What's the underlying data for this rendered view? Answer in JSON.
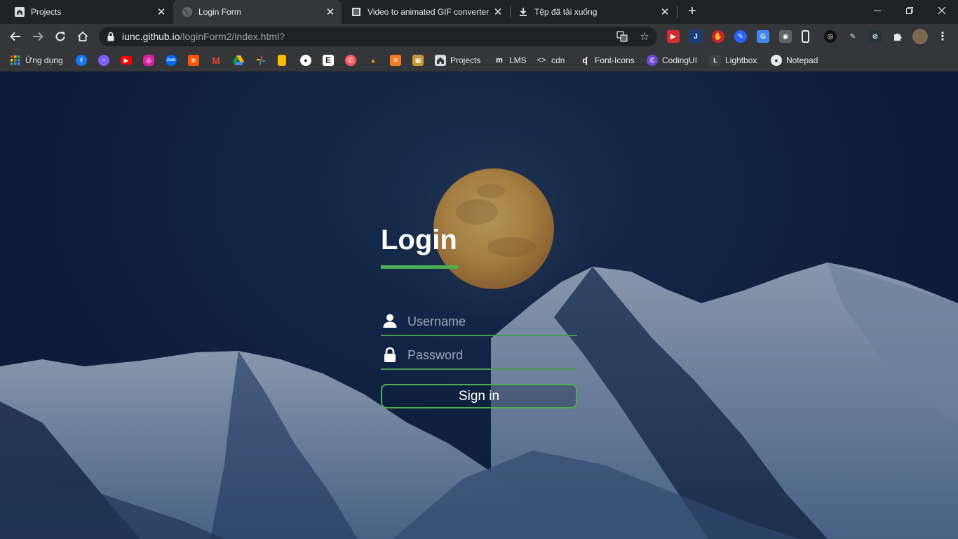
{
  "browser": {
    "tabs": [
      {
        "title": "Projects",
        "favicon": "home-icon"
      },
      {
        "title": "Login Form",
        "favicon": "globe-icon"
      },
      {
        "title": "Video to animated GIF converter",
        "favicon": "film-icon"
      },
      {
        "title": "Tệp đã tải xuống",
        "favicon": "download-icon"
      }
    ],
    "active_tab": 1,
    "address": {
      "host": "iunc.github.io",
      "path": "/loginForm2/index.html?"
    },
    "bookmarks": [
      {
        "label": "Ứng dụng",
        "icon": "apps-icon"
      },
      {
        "label": "",
        "icon": "facebook-icon"
      },
      {
        "label": "",
        "icon": "messenger-icon"
      },
      {
        "label": "",
        "icon": "youtube-icon"
      },
      {
        "label": "",
        "icon": "instagram-icon"
      },
      {
        "label": "",
        "icon": "zalo-icon"
      },
      {
        "label": "",
        "icon": "soundcloud-icon"
      },
      {
        "label": "",
        "icon": "gmail-icon"
      },
      {
        "label": "",
        "icon": "drive-icon"
      },
      {
        "label": "",
        "icon": "photos-icon"
      },
      {
        "label": "",
        "icon": "keep-icon"
      },
      {
        "label": "",
        "icon": "github-icon"
      },
      {
        "label": "",
        "icon": "e-icon"
      },
      {
        "label": "",
        "icon": "circle-icon"
      },
      {
        "label": "",
        "icon": "freecodecamp-icon"
      },
      {
        "label": "",
        "icon": "xampp-icon"
      },
      {
        "label": "",
        "icon": "box-icon"
      },
      {
        "label": "Projects",
        "icon": "home-icon"
      },
      {
        "label": "LMS",
        "icon": "lms-icon"
      },
      {
        "label": "cdn",
        "icon": "code-icon"
      },
      {
        "label": "Font-Icons",
        "icon": "font-icon"
      },
      {
        "label": "CodingUI",
        "icon": "codingui-icon"
      },
      {
        "label": "Lightbox",
        "icon": "lightbox-icon"
      },
      {
        "label": "Notepad",
        "icon": "globe-icon"
      }
    ]
  },
  "login": {
    "title": "Login",
    "username_placeholder": "Username",
    "password_placeholder": "Password",
    "submit_label": "Sign in"
  },
  "colors": {
    "accent": "#4caf50",
    "moon": "#e8b150",
    "sky": "#14284a"
  }
}
